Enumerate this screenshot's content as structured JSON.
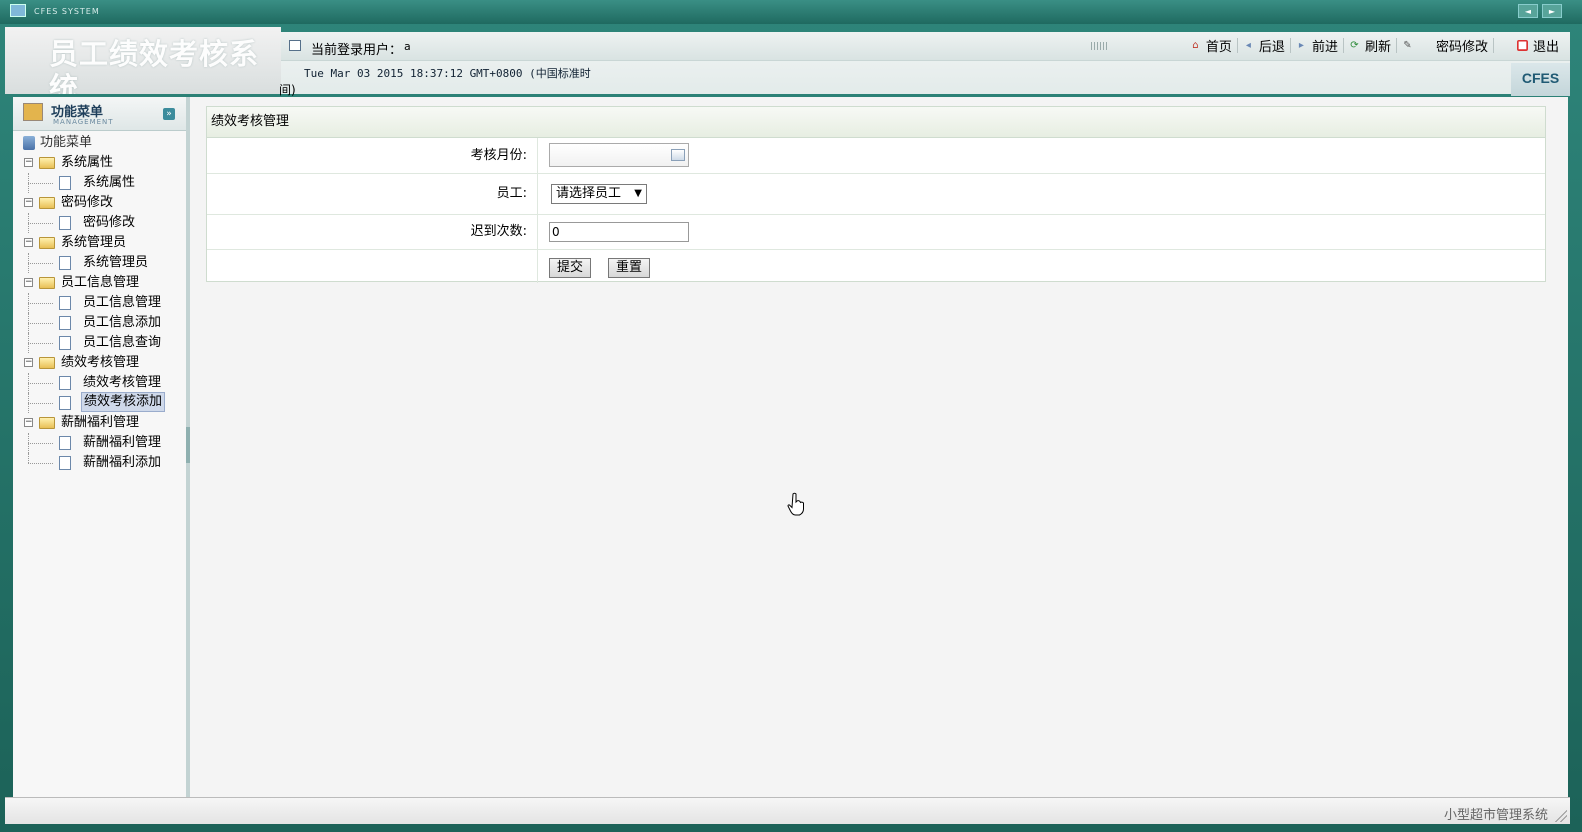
{
  "window": {
    "title": "CFES SYSTEM",
    "nav_prev": "◄",
    "nav_next": "►"
  },
  "header": {
    "system_name": "员工绩效考核系统",
    "user_label": "当前登录用户：",
    "user_value": "a",
    "datetime": "Tue Mar 03 2015 18:37:12 GMT+0800 (中国标准时",
    "datetime_wrap": "间)",
    "logo": "CFES",
    "links": [
      {
        "label": "首页",
        "icon": "home-icon"
      },
      {
        "label": "后退",
        "icon": "back-icon"
      },
      {
        "label": "前进",
        "icon": "forward-icon"
      },
      {
        "label": "刷新",
        "icon": "refresh-icon"
      },
      {
        "label": "密码修改",
        "icon": "edit-icon"
      },
      {
        "label": "退出",
        "icon": "exit-icon"
      }
    ]
  },
  "sidebar": {
    "title": "功能菜单",
    "subtitle": "MANAGEMENT",
    "toggle": "»",
    "root": "功能菜单",
    "groups": [
      {
        "label": "系统属性",
        "items": [
          "系统属性"
        ]
      },
      {
        "label": "密码修改",
        "items": [
          "密码修改"
        ]
      },
      {
        "label": "系统管理员",
        "items": [
          "系统管理员"
        ]
      },
      {
        "label": "员工信息管理",
        "items": [
          "员工信息管理",
          "员工信息添加",
          "员工信息查询"
        ]
      },
      {
        "label": "绩效考核管理",
        "items": [
          "绩效考核管理",
          "绩效考核添加"
        ]
      },
      {
        "label": "薪酬福利管理",
        "items": [
          "薪酬福利管理",
          "薪酬福利添加"
        ]
      }
    ],
    "selected": "绩效考核添加"
  },
  "form": {
    "title": "绩效考核管理",
    "month_label": "考核月份:",
    "month_value": "",
    "employee_label": "员工:",
    "employee_selected": "请选择员工",
    "late_label": "迟到次数:",
    "late_value": "0",
    "submit": "提交",
    "reset": "重置"
  },
  "status": {
    "text": "小型超市管理系统"
  },
  "colors": {
    "frame": "#2a7e74",
    "panel_border": "#cfdccf",
    "selected_bg": "#cfd9ea"
  }
}
